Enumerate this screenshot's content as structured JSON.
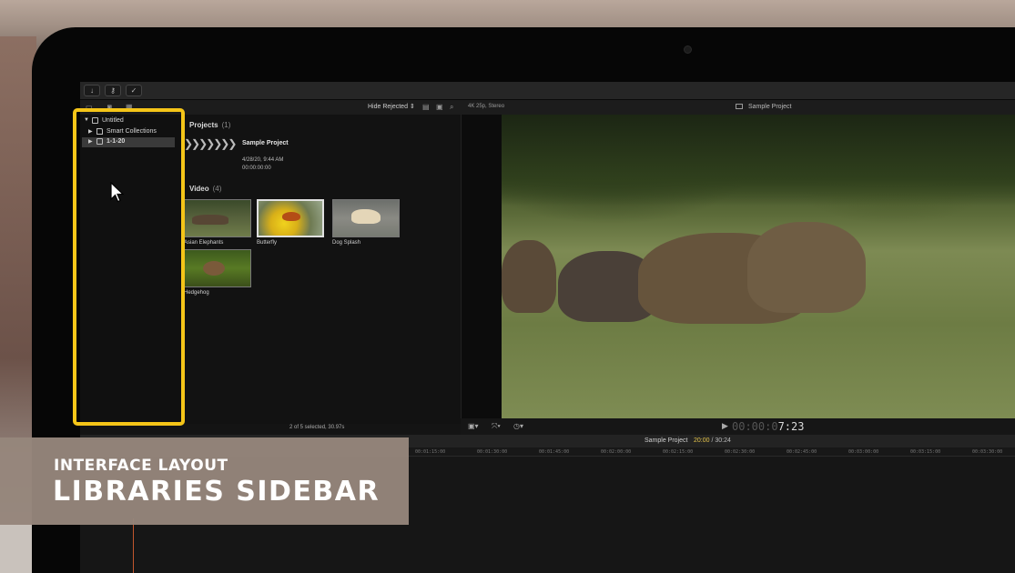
{
  "caption": {
    "subtitle": "INTERFACE LAYOUT",
    "title": "LIBRARIES SIDEBAR"
  },
  "toolbar": {
    "import_icon": "↓",
    "keyword_icon": "⚷",
    "background_tasks_icon": "✓"
  },
  "browser_toolbar": {
    "filter_label": "Hide Rejected ⇕"
  },
  "sidebar": {
    "items": [
      {
        "label": "Untitled",
        "icon": "library-icon",
        "expanded": true
      },
      {
        "label": "Smart Collections",
        "icon": "folder-icon",
        "expanded": false
      },
      {
        "label": "1-1-20",
        "icon": "event-icon",
        "expanded": false,
        "selected": true
      }
    ]
  },
  "browser": {
    "projects_section": {
      "title": "Projects",
      "count": "(1)"
    },
    "project": {
      "name": "Sample Project",
      "date": "4/28/20, 9:44 AM",
      "duration": "00:00:00:00",
      "strip": "❯❯❯❯❯❯❯"
    },
    "video_section": {
      "title": "Video",
      "count": "(4)"
    },
    "clips": [
      {
        "label": "Asian Elephants",
        "selected": false
      },
      {
        "label": "Butterfly",
        "selected": true
      },
      {
        "label": "Dog Splash",
        "selected": false
      },
      {
        "label": "Hedgehog",
        "selected": false
      }
    ],
    "status": "2 of 5 selected, 30.97s"
  },
  "viewer": {
    "format": "4K 25p, Stereo",
    "title": "Sample Project",
    "timecode_dim": "00:00:0",
    "timecode": "7:23"
  },
  "timeline": {
    "project": "Sample Project",
    "position": "20:00",
    "duration": " / 30:24",
    "ruler": [
      "00:01:15:00",
      "00:01:30:00",
      "00:01:45:00",
      "00:02:00:00",
      "00:02:15:00",
      "00:02:30:00",
      "00:02:45:00",
      "00:03:00:00",
      "00:03:15:00",
      "00:03:30:00"
    ]
  },
  "colors": {
    "highlight": "#f5c518",
    "caption_bg": "#96867c",
    "timeline_yellow": "#e5c44b"
  }
}
